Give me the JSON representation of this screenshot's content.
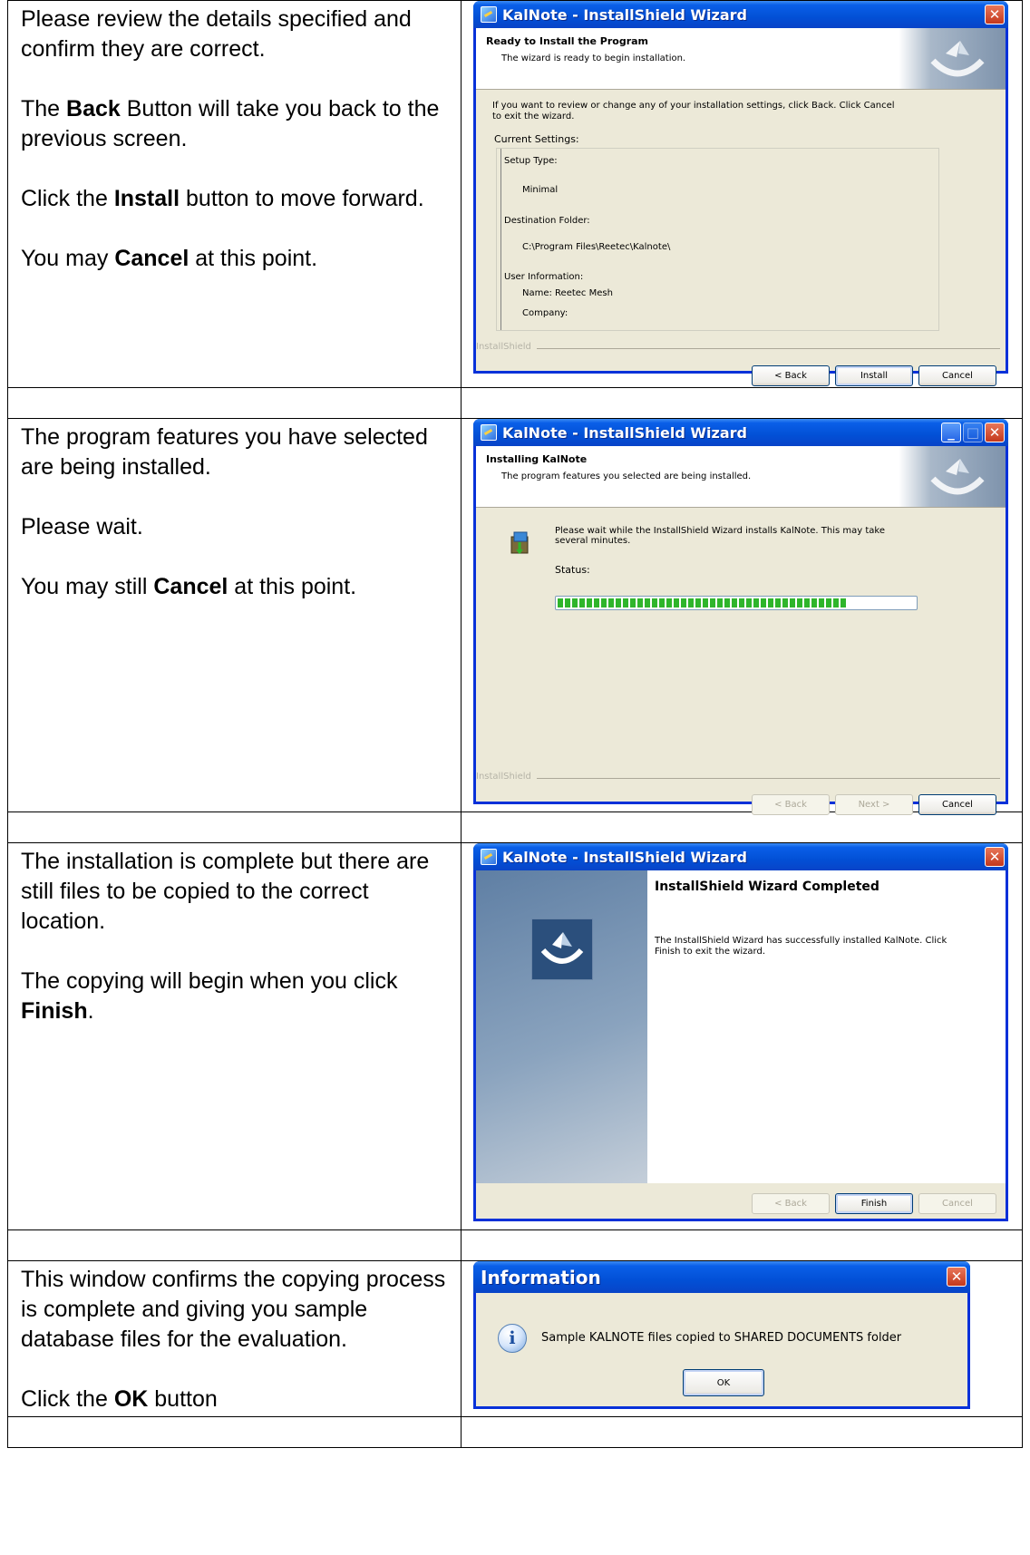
{
  "rows": [
    {
      "instructions": [
        [
          {
            "t": "Please review the details specified and confirm they are correct."
          }
        ],
        [
          {
            "t": "The "
          },
          {
            "b": "Back"
          },
          {
            "t": " Button will take you back to the previous screen."
          }
        ],
        [
          {
            "t": "Click the "
          },
          {
            "b": "Install"
          },
          {
            "t": " button to move forward."
          }
        ],
        [
          {
            "t": "You may "
          },
          {
            "b": "Cancel"
          },
          {
            "t": " at this point."
          }
        ]
      ]
    },
    {
      "instructions": [
        [
          {
            "t": "The program features you have selected are being installed."
          }
        ],
        [
          {
            "t": "Please wait."
          }
        ],
        [
          {
            "t": "You may still "
          },
          {
            "b": "Cancel"
          },
          {
            "t": " at this point."
          }
        ]
      ]
    },
    {
      "instructions": [
        [
          {
            "t": "The installation is complete but there are still files to be copied to the correct location."
          }
        ],
        [
          {
            "t": "The copying will begin when you click "
          },
          {
            "b": "Finish"
          },
          {
            "t": "."
          }
        ]
      ]
    },
    {
      "instructions": [
        [
          {
            "t": "This window confirms the copying process is complete and giving you sample database files for the evaluation."
          }
        ],
        [
          {
            "t": "Click the "
          },
          {
            "b": "OK"
          },
          {
            "t": " button"
          }
        ]
      ]
    }
  ],
  "win1": {
    "title": "KalNote - InstallShield Wizard",
    "heading": "Ready to Install the Program",
    "subheading": "The wizard is ready to begin installation.",
    "intro_line1": "If you want to review or change any of your installation settings, click Back. Click Cancel",
    "intro_line2": "to exit the wizard.",
    "current_settings_label": "Current Settings:",
    "setup_type_label": "Setup Type:",
    "setup_type_value": "Minimal",
    "destination_label": "Destination Folder:",
    "destination_value": "C:\\Program Files\\Reetec\\Kalnote\\",
    "user_info_label": "User Information:",
    "user_name": "Name: Reetec Mesh",
    "user_company": "Company:",
    "brand": "InstallShield",
    "back_label": "< Back",
    "install_label": "Install",
    "cancel_label": "Cancel"
  },
  "win2": {
    "title": "KalNote - InstallShield Wizard",
    "heading": "Installing KalNote",
    "subheading": "The program features you selected are being installed.",
    "message_line1": "Please wait while the InstallShield Wizard installs KalNote. This may take",
    "message_line2": "several minutes.",
    "status_label": "Status:",
    "progress_fraction": 0.81,
    "brand": "InstallShield",
    "back_label": "< Back",
    "next_label": "Next >",
    "cancel_label": "Cancel"
  },
  "win3": {
    "title": "KalNote - InstallShield Wizard",
    "heading": "InstallShield Wizard Completed",
    "message_line1": "The InstallShield Wizard has successfully installed KalNote. Click",
    "message_line2": "Finish to exit the wizard.",
    "back_label": "< Back",
    "finish_label": "Finish",
    "cancel_label": "Cancel"
  },
  "win4": {
    "title": "Information",
    "message": "Sample KALNOTE files copied to SHARED DOCUMENTS folder",
    "ok_label": "OK"
  },
  "colors": {
    "xp_title_blue": "#0250d6",
    "xp_face": "#ece9d8",
    "progress_green": "#2fb52b"
  },
  "icons": [
    "installer-app-icon",
    "close-icon",
    "minimize-icon",
    "maximize-icon",
    "installshield-logo-icon",
    "install-package-icon",
    "information-icon"
  ]
}
